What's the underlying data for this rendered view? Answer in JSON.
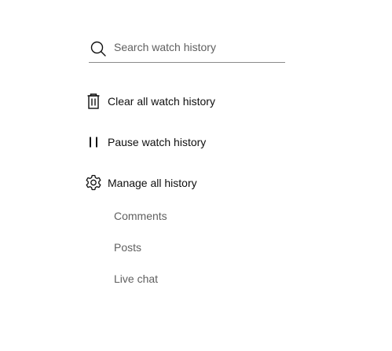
{
  "search": {
    "placeholder": "Search watch history",
    "icon": "search-icon"
  },
  "actions": [
    {
      "label": "Clear all watch history",
      "icon": "trash-icon"
    },
    {
      "label": "Pause watch history",
      "icon": "pause-icon"
    },
    {
      "label": "Manage all history",
      "icon": "gear-icon"
    }
  ],
  "manage_links": [
    {
      "label": "Comments"
    },
    {
      "label": "Posts"
    },
    {
      "label": "Live chat"
    }
  ],
  "colors": {
    "background": "#ffffff",
    "primary_text": "#0f0f0f",
    "secondary_text": "#606060",
    "underline": "#8a8a8a"
  }
}
